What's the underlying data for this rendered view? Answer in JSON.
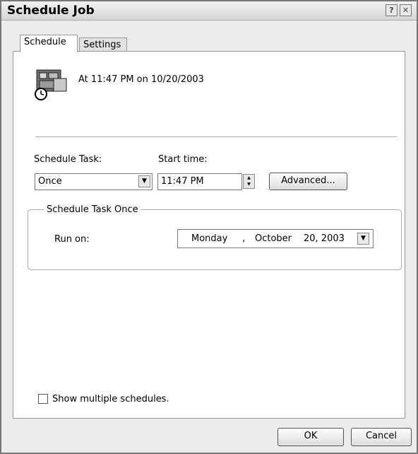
{
  "window": {
    "title": "Schedule Job"
  },
  "titlebar_buttons": {
    "help": "?",
    "close": "✕"
  },
  "tabs": [
    {
      "label": "Schedule"
    },
    {
      "label": "Settings"
    }
  ],
  "summary": {
    "text": "At 11:47 PM on 10/20/2003"
  },
  "schedule_task": {
    "label": "Schedule Task:",
    "value": "Once"
  },
  "start_time": {
    "label": "Start time:",
    "value": "11:47 PM"
  },
  "advanced_button": {
    "label": "Advanced..."
  },
  "group": {
    "legend": "Schedule Task Once",
    "run_on_label": "Run on:",
    "date": {
      "weekday": "Monday",
      "sep": ",",
      "month": "October",
      "day_year": "20, 2003"
    }
  },
  "show_multiple": {
    "label": "Show multiple schedules."
  },
  "footer": {
    "ok": "OK",
    "cancel": "Cancel"
  },
  "colors": {
    "window_bg": "#ececec",
    "panel_bg": "#ffffff",
    "border": "#777777"
  },
  "icons": {
    "task": "scheduled-task-icon",
    "dropdown": "chevron-down-icon"
  }
}
